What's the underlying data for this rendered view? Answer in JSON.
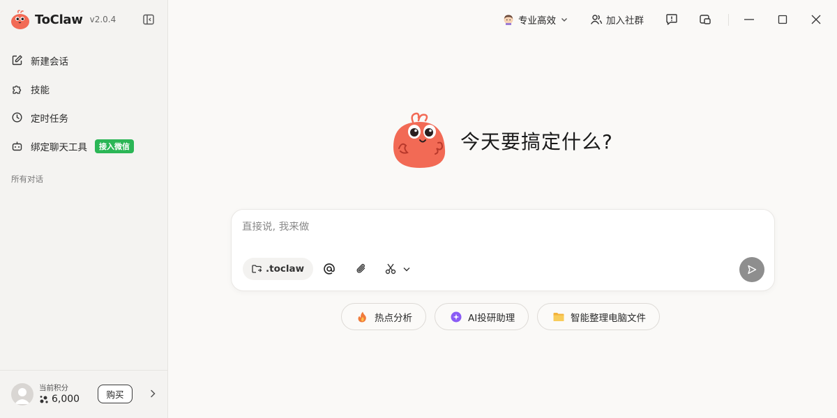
{
  "brand": {
    "name": "ToClaw",
    "version": "v2.0.4"
  },
  "sidebar": {
    "items": [
      {
        "label": "新建会话",
        "icon": "edit-icon"
      },
      {
        "label": "技能",
        "icon": "puzzle-icon"
      },
      {
        "label": "定时任务",
        "icon": "clock-icon"
      },
      {
        "label": "绑定聊天工具",
        "icon": "robot-icon",
        "badge": "接入微信"
      }
    ],
    "section_label": "所有对话",
    "footer": {
      "points_label": "当前积分",
      "points_value": "6,000",
      "buy_label": "购买"
    }
  },
  "header": {
    "mode_label": "专业高效",
    "community_label": "加入社群"
  },
  "main": {
    "title": "今天要搞定什么?",
    "input_placeholder": "直接说, 我来做",
    "folder_chip": ".toclaw",
    "quick_actions": [
      {
        "label": "热点分析",
        "icon": "fire-icon"
      },
      {
        "label": "AI投研助理",
        "icon": "ai-sparkle-icon"
      },
      {
        "label": "智能整理电脑文件",
        "icon": "folder-icon"
      }
    ]
  },
  "colors": {
    "accent_green": "#2bb656",
    "mascot": "#f26a55",
    "send_button": "#8e8e8e",
    "background": "#faf9f7"
  }
}
